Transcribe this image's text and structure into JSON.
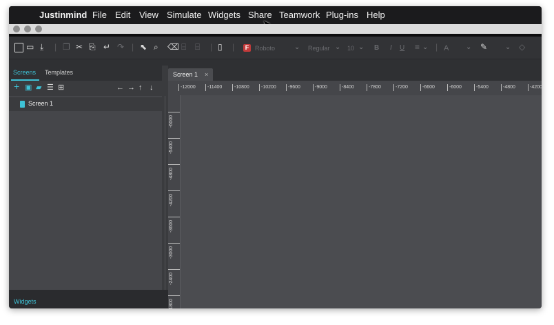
{
  "menubar": {
    "app_name": "Justinmind",
    "items": [
      "File",
      "Edit",
      "View",
      "Simulate",
      "Widgets",
      "Share",
      "Teamwork",
      "Plug-ins",
      "Help"
    ]
  },
  "toolbar": {
    "font_name": "Roboto",
    "font_style": "Regular",
    "font_size": "10",
    "bold": "B",
    "italic": "I",
    "underline": "U",
    "text_color": "A"
  },
  "left_panel": {
    "tabs": [
      "Screens",
      "Templates"
    ],
    "active_tab": "Screens",
    "screens": [
      {
        "label": "Screen 1"
      }
    ],
    "widgets_label": "Widgets"
  },
  "canvas": {
    "tab_label": "Screen 1",
    "tab_close": "×",
    "ruler_h": [
      "-12000",
      "-11400",
      "-10800",
      "-10200",
      "-9600",
      "-9000",
      "-8400",
      "-7800",
      "-7200",
      "-6600",
      "-6000",
      "-5400",
      "-4800",
      "-4200"
    ],
    "ruler_v": [
      "-6000",
      "-5400",
      "-4800",
      "-4200",
      "-3600",
      "-3000",
      "-2400",
      "-1800"
    ]
  },
  "colors": {
    "accent": "#3ec2d6",
    "panel_bg": "#45464a",
    "canvas_bg": "#4b4c50",
    "menubar_bg": "#1b1b1d"
  }
}
